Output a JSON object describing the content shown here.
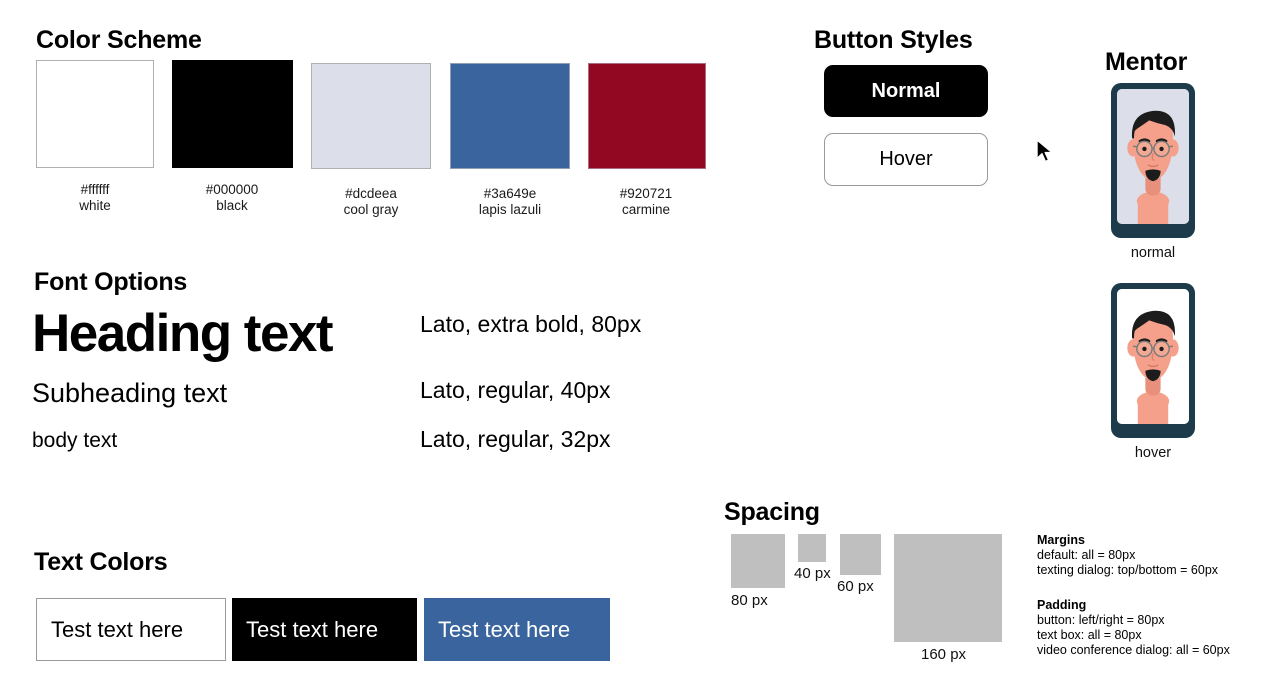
{
  "color_scheme": {
    "title": "Color Scheme",
    "swatches": [
      {
        "hex_label": "#ffffff",
        "name": "white",
        "hex": "#ffffff"
      },
      {
        "hex_label": "#000000",
        "name": "black",
        "hex": "#000000"
      },
      {
        "hex_label": "#dcdeea",
        "name": "cool gray",
        "hex": "#dcdeea"
      },
      {
        "hex_label": "#3a649e",
        "name": "lapis lazuli",
        "hex": "#3a649e"
      },
      {
        "hex_label": "#920721",
        "name": "carmine",
        "hex": "#920721"
      }
    ]
  },
  "button_styles": {
    "title": "Button Styles",
    "buttons": [
      {
        "label": "Normal",
        "state": "normal"
      },
      {
        "label": "Hover",
        "state": "hover"
      }
    ]
  },
  "mentor": {
    "title": "Mentor",
    "variants": [
      {
        "caption": "normal",
        "screen_bg": "#dcdeea",
        "frame": "#1d3b4b"
      },
      {
        "caption": "hover",
        "screen_bg": "#ffffff",
        "frame": "#1d3b4b"
      }
    ],
    "avatar_colors": {
      "skin": "#f4a08a",
      "skin_shadow": "#e8907c",
      "hair": "#1c1c1c",
      "beard": "#1c1c1c",
      "glasses": "#6b6b6b",
      "eye": "#1c1c1c"
    }
  },
  "font_options": {
    "title": "Font Options",
    "rows": [
      {
        "sample": "Heading text",
        "spec": "Lato, extra bold, 80px"
      },
      {
        "sample": "Subheading text",
        "spec": "Lato, regular, 40px"
      },
      {
        "sample": "body text",
        "spec": "Lato, regular, 32px"
      }
    ]
  },
  "text_colors": {
    "title": "Text Colors",
    "samples": [
      {
        "text": "Test text here",
        "bg": "#ffffff",
        "fg": "#000000",
        "border": "#9a9a9a"
      },
      {
        "text": "Test text here",
        "bg": "#000000",
        "fg": "#ffffff",
        "border": "#000000"
      },
      {
        "text": "Test text here",
        "bg": "#3a649e",
        "fg": "#ffffff",
        "border": "#3a649e"
      }
    ]
  },
  "spacing": {
    "title": "Spacing",
    "boxes": [
      {
        "label": "80 px",
        "size": 80
      },
      {
        "label": "40 px",
        "size": 40
      },
      {
        "label": "60 px",
        "size": 60
      },
      {
        "label": "160 px",
        "size": 160
      }
    ],
    "box_color": "#bfbfbf"
  },
  "notes": {
    "margins": {
      "title": "Margins",
      "lines": [
        "default: all = 80px",
        "texting dialog: top/bottom = 60px"
      ]
    },
    "padding": {
      "title": "Padding",
      "lines": [
        "button: left/right = 80px",
        "text box: all = 80px",
        "video conference dialog: all = 60px"
      ]
    }
  },
  "cursor": {
    "name": "arrow-pointer"
  }
}
